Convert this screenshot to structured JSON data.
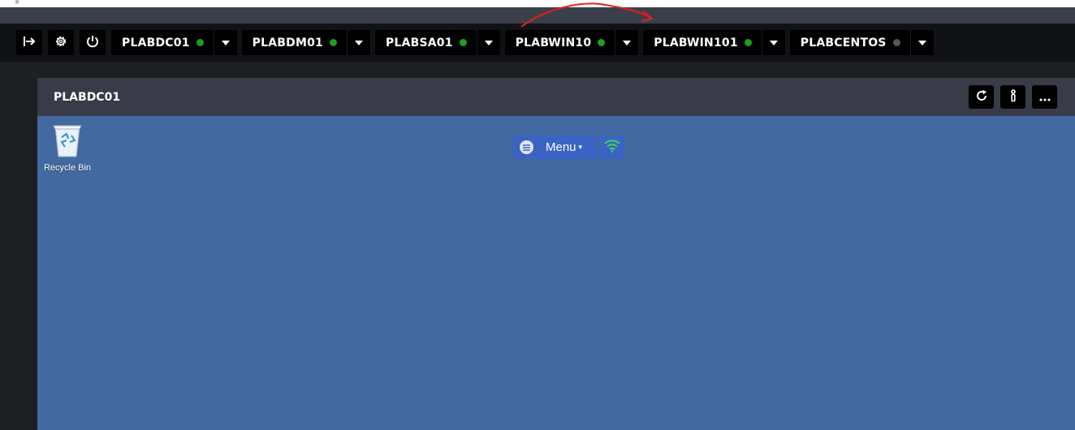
{
  "colors": {
    "status_online": "#1f9d1f",
    "status_offline": "#55585f",
    "desktop_bg": "#426aa1",
    "menu_blue": "#3b63c4",
    "annotation_red": "#e02020"
  },
  "toolbar": {
    "tool_icons": [
      "sign-out-icon",
      "gear-icon",
      "power-icon"
    ],
    "tabs": [
      {
        "label": "PLABDC01",
        "status": "online"
      },
      {
        "label": "PLABDM01",
        "status": "online"
      },
      {
        "label": "PLABSA01",
        "status": "online"
      },
      {
        "label": "PLABWIN10",
        "status": "online"
      },
      {
        "label": "PLABWIN101",
        "status": "online"
      },
      {
        "label": "PLABCENTOS",
        "status": "offline"
      }
    ]
  },
  "panel": {
    "title": "PLABDC01",
    "action_icons": [
      "refresh-icon",
      "info-icon",
      "more-icon"
    ]
  },
  "desktop": {
    "recycle_bin_label": "Recycle Bin",
    "menu_label": "Menu",
    "menu_arrow": "▾"
  }
}
